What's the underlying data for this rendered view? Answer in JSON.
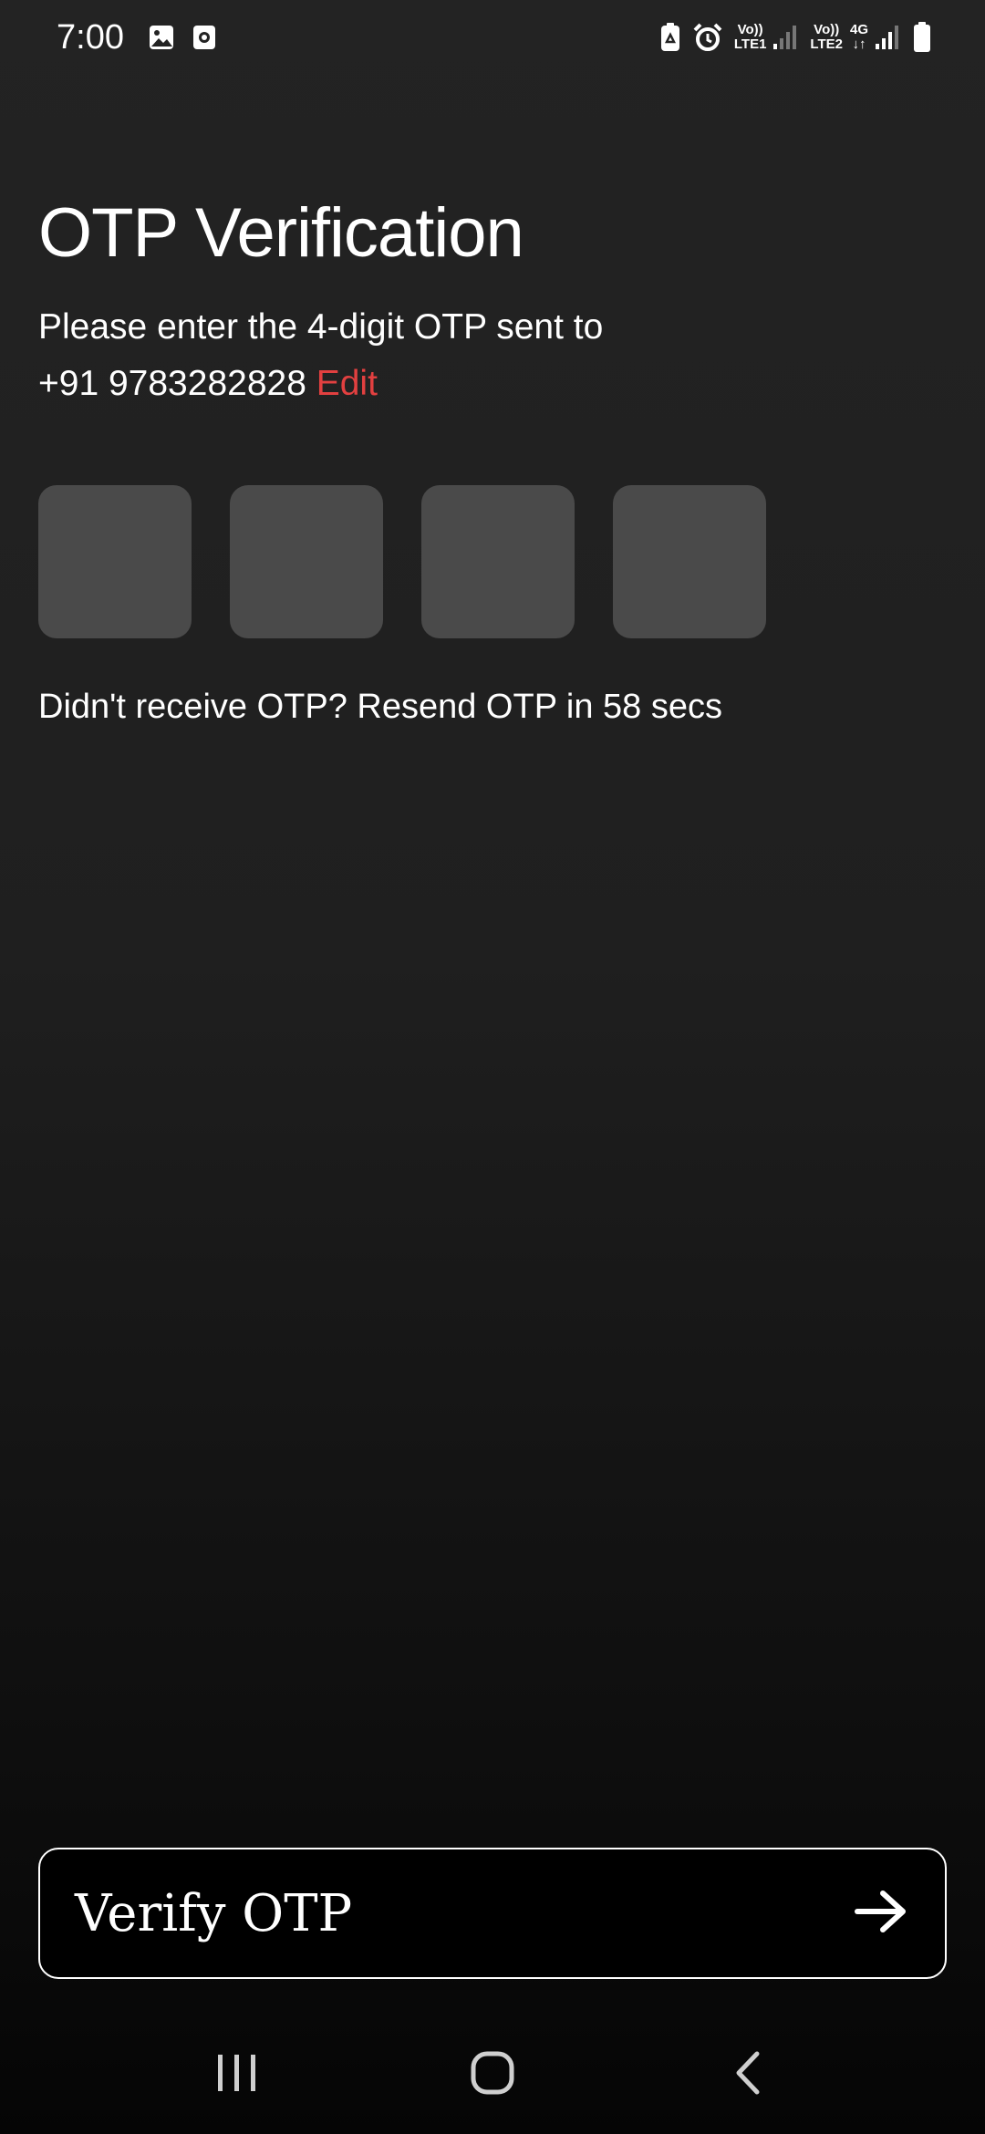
{
  "status_bar": {
    "time": "7:00",
    "left_icons": [
      "image-icon",
      "screen-recorder-icon"
    ],
    "right_icons": [
      "battery-saver-icon",
      "alarm-icon",
      "signal-sim1-icon",
      "signal-sim2-icon",
      "battery-icon"
    ],
    "sim1_label_top": "Vo))",
    "sim1_label_bottom": "LTE1",
    "sim2_label_top": "Vo))",
    "sim2_label_bottom": "LTE2",
    "network_type": "4G"
  },
  "page": {
    "title": "OTP Verification",
    "subtitle_line1": "Please enter the 4-digit OTP sent to",
    "phone_number": "+91 9783282828",
    "edit_label": "Edit",
    "otp_digits": [
      "",
      "",
      "",
      ""
    ],
    "resend_text": "Didn't receive OTP? Resend OTP in 58 secs"
  },
  "verify_button": {
    "label": "Verify OTP",
    "icon": "arrow-right-icon"
  },
  "nav_bar": {
    "items": [
      "recent-apps-icon",
      "home-icon",
      "back-icon"
    ]
  },
  "colors": {
    "accent": "#e24040",
    "otp_box": "#4a4a4a",
    "background_top": "#232323",
    "background_bottom": "#050505"
  }
}
